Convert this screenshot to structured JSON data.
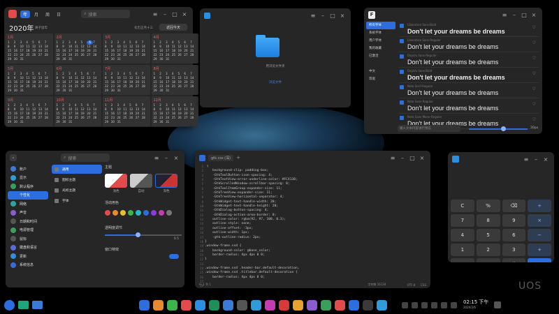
{
  "calendar": {
    "tabs": [
      "年",
      "月",
      "周",
      "日"
    ],
    "search_placeholder": "搜索",
    "year_title": "2020年",
    "lunar_year": "庚子鼠年",
    "lunar_today": "农历正月十三",
    "today_button": "返回今天",
    "months": [
      "1月",
      "2月",
      "3月",
      "4月",
      "5月",
      "6月",
      "7月",
      "8月",
      "9月",
      "10月",
      "11月",
      "12月"
    ]
  },
  "files": {
    "folder_caption": "用浏览文件夹",
    "link_text": "浏览文件"
  },
  "fonts": {
    "sidebar": [
      "所有字体",
      "系统字体",
      "用户字体",
      "我的收藏",
      "已激活",
      "",
      "中文",
      "等宽"
    ],
    "rows": [
      {
        "name": "Liberation Sans-Bold",
        "sample": "Don't let your dreams be dreams",
        "bold": true
      },
      {
        "name": "Liberation Sans-Regular",
        "sample": "Don't let your dreams be dreams",
        "bold": false
      },
      {
        "name": "DejaVu Sans-Regular",
        "sample": "Don't let your dreams be dreams",
        "bold": false
      },
      {
        "name": "DejaVu Sans-Bold",
        "sample": "Don't let your dreams be dreams",
        "bold": true
      },
      {
        "name": "Noto Serif-Regular",
        "sample": "Don't let your dreams be dreams",
        "bold": false
      },
      {
        "name": "Noto Sans-Regular",
        "sample": "Don't let your dreams be dreams",
        "bold": false
      },
      {
        "name": "Noto Sans Mono-Regular",
        "sample": "Don't let your dreams be dreams",
        "bold": false
      }
    ],
    "preview_placeholder": "输入文本内容进行预览",
    "size_label": "30px"
  },
  "settings": {
    "search_placeholder": "搜索",
    "sidebar": [
      "账户",
      "显示",
      "默认程序",
      "个性化",
      "网络",
      "声音",
      "日期和时间",
      "电源管理",
      "鼠标",
      "键盘和语言",
      "更新",
      "系统信息"
    ],
    "sidebar_colors": [
      "#3a7bd5",
      "#2f9bd8",
      "#3a9e5c",
      "#2c6ee0",
      "#2ba3a3",
      "#8a5cd0",
      "#555",
      "#3aa05a",
      "#555",
      "#5b6bd5",
      "#2f8fd8",
      "#3a6bd5"
    ],
    "subnav": [
      "通用",
      "图标主题",
      "光标主题",
      "字体"
    ],
    "theme_heading": "主题",
    "themes": [
      "浅色",
      "自动",
      "深色"
    ],
    "accent_heading": "活动用色",
    "accent_colors": [
      "#e24b4b",
      "#e58a2f",
      "#e6c12f",
      "#3bb54a",
      "#2db5c8",
      "#2c6ee0",
      "#8a3ce0",
      "#c43cb0",
      "#777"
    ],
    "transparency_label": "透明度调节",
    "transparency_value": "0.5",
    "effects_label": "窗口特效"
  },
  "editor": {
    "tab_label": "gtk.css (深)",
    "code": " {\n    background-clip: padding-box;\n    -GtkToolButton-icon-spacing: 4;\n    -GtkTextView-error-underline-color: #FC4138;\n    -GtkScrolledWindow-scrollbar-spacing: 0;\n    -GtkToolItemGroup-expander-size: 11;\n    -GtkTreeView-expander-size: 11;\n    -GtkTreeView-horizontal-separator: 4;\n    -GtkWidget-text-handle-width: 20;\n    -GtkWidget-text-handle-height: 20;\n    -GtkDialog-button-spacing: 4;\n    -GtkDialog-action-area-border: 0;\n    outline-color: rgba(92, 97, 108, 0.3);\n    outline-style: none;\n    outline-offset: -3px;\n    outline-width: 1px;\n    -gtk-outline-radius: 2px;\n}\n.window-frame.ssd {\n    background-color: @base_color;\n    border-radius: 4px 4px 0 0;\n}\n\n.window-frame.ssd .header-bar.default-decoration,\n.window-frame.ssd .titlebar.default-decoration {\n    border-radius: 4px 4px 0 0;\n    background-color: @base_Color;\n    padding: 8px;\n}",
    "line_numbers": "1\n2\n3\n4\n5\n6\n7\n8\n9\n10\n11\n12\n13\n14\n15\n16\n17\n18\n19\n20\n21\n22\n23\n24\n25\n26\n27\n28\n29",
    "status_left": "行 1 列 1",
    "status_mid": "字符数 16134",
    "status_enc": "UTF-8",
    "status_lang": "CSS"
  },
  "calculator": {
    "keys": [
      "C",
      "%",
      "⌫",
      "÷",
      "7",
      "8",
      "9",
      "×",
      "4",
      "5",
      "6",
      "−",
      "1",
      "2",
      "3",
      "+",
      "0",
      ".",
      "()",
      "="
    ]
  },
  "watermark": "UOS",
  "dock": {
    "time": "02:15 下午",
    "date": "2020/2/6"
  }
}
